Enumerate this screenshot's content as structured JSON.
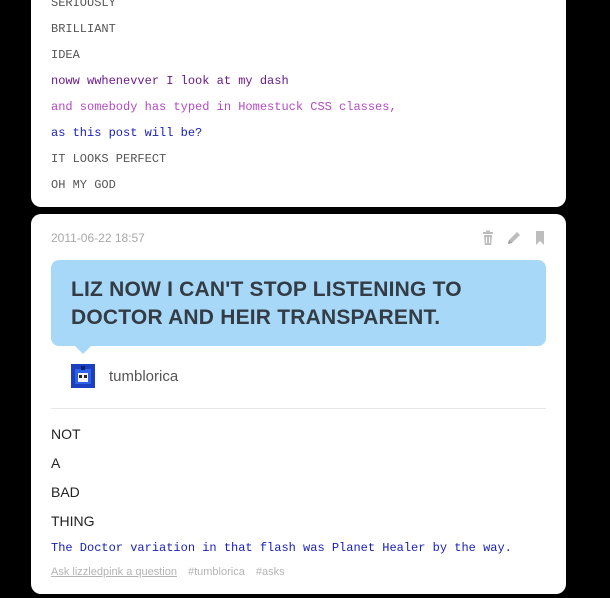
{
  "previous_post": {
    "lines": [
      {
        "text": "SERIOUSLY",
        "color": "#555555"
      },
      {
        "text": "BRILLIANT",
        "color": "#555555"
      },
      {
        "text": "IDEA",
        "color": "#555555"
      },
      {
        "text": "noww wwhenevver I look at my dash",
        "color": "#6a1a8a"
      },
      {
        "text": "and somebody has typed in Homestuck CSS classes,",
        "color": "#b34ac2"
      },
      {
        "text": "as this post will be?",
        "color": "#1a21b8"
      },
      {
        "text": "IT LOOKS PERFECT",
        "color": "#555555"
      },
      {
        "text": "OH MY GOD",
        "color": "#555555"
      }
    ]
  },
  "post": {
    "timestamp": "2011-06-22 18:57",
    "question": "LIZ NOW I CAN'T STOP LISTENING TO DOCTOR AND HEIR TRANSPARENT.",
    "asker": "tumblorica",
    "answer_lines": [
      "NOT",
      "A",
      "BAD",
      "THING"
    ],
    "note": "The Doctor variation in that flash was Planet Healer by the way.",
    "footer": {
      "ask_link": "Ask lizzledpink a question",
      "tags": [
        "#tumblorica",
        "#asks"
      ]
    },
    "controls": [
      "trash-icon",
      "pencil-icon",
      "bookmark-icon"
    ]
  }
}
